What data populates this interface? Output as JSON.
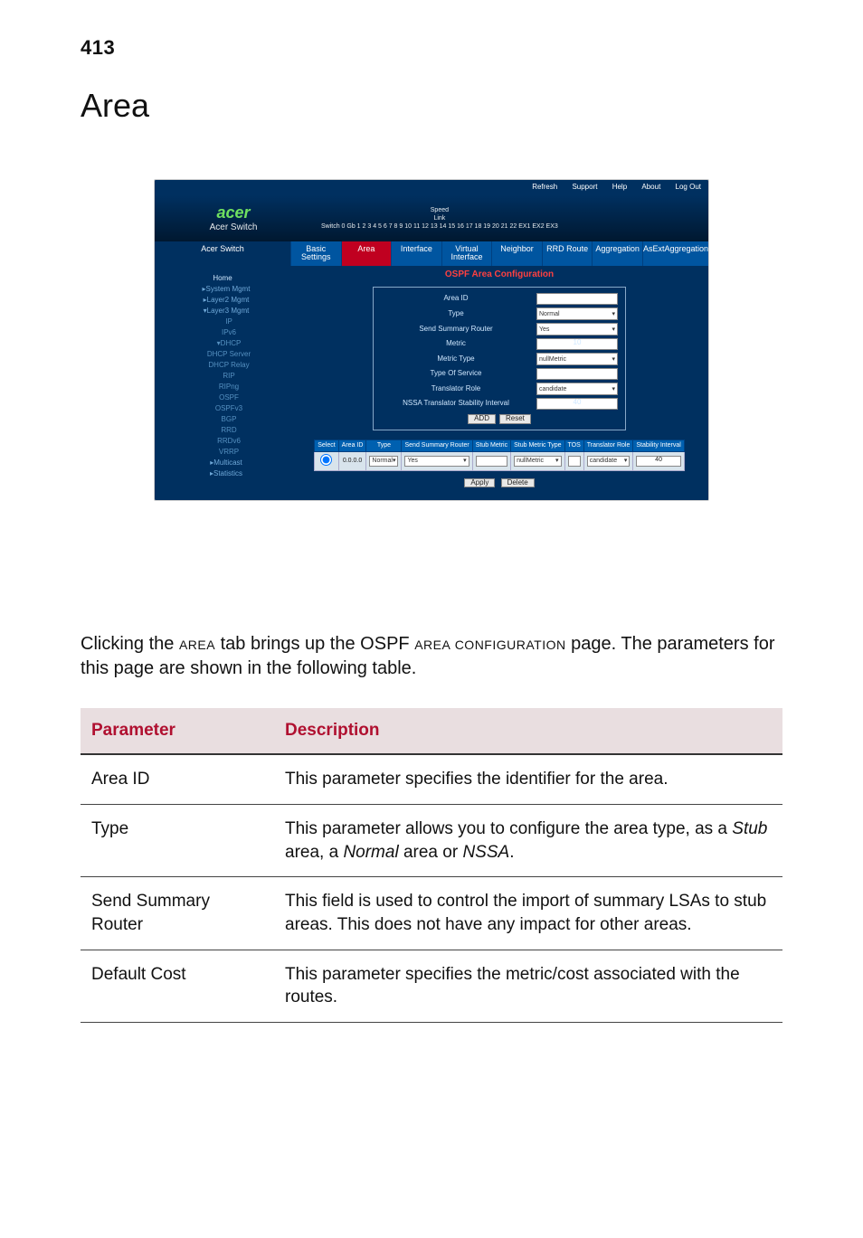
{
  "page_number": "413",
  "title": "Area",
  "figure": {
    "topbar": [
      "Refresh",
      "Support",
      "Help",
      "About",
      "Log Out"
    ],
    "brand": {
      "logo": "acer",
      "sub": "Acer Switch"
    },
    "portlabels": {
      "l1": "Speed",
      "l2": "Link",
      "l3": "Switch 0 Gb 1  2  3  4  5  6  7  8  9 10 11 12 13 14 15 16 17 18 19 20 21 22 EX1 EX2 EX3"
    },
    "tabs_side": "Acer Switch",
    "tabs": [
      "Basic Settings",
      "Area",
      "Interface",
      "Virtual Interface",
      "Neighbor",
      "RRD Route",
      "Aggregation",
      "AsExtAggregation"
    ],
    "tabs_active_index": 1,
    "side_items": [
      {
        "t": "Home",
        "cls": "hdr"
      },
      {
        "t": "▸System Mgmt",
        "cls": "sub"
      },
      {
        "t": "▸Layer2 Mgmt",
        "cls": "sub"
      },
      {
        "t": "▾Layer3 Mgmt",
        "cls": "sub"
      },
      {
        "t": "IP",
        "cls": "sub2"
      },
      {
        "t": "IPv6",
        "cls": "sub2"
      },
      {
        "t": "▾DHCP",
        "cls": "sub2"
      },
      {
        "t": "DHCP Server",
        "cls": "sub2"
      },
      {
        "t": "DHCP Relay",
        "cls": "sub2"
      },
      {
        "t": "RIP",
        "cls": "sub2"
      },
      {
        "t": "RIPng",
        "cls": "sub2"
      },
      {
        "t": "OSPF",
        "cls": "sub2"
      },
      {
        "t": "OSPFv3",
        "cls": "sub2"
      },
      {
        "t": "BGP",
        "cls": "sub2"
      },
      {
        "t": "RRD",
        "cls": "sub2"
      },
      {
        "t": "RRDv6",
        "cls": "sub2"
      },
      {
        "t": "VRRP",
        "cls": "sub2"
      },
      {
        "t": "▸Multicast",
        "cls": "sub"
      },
      {
        "t": "▸Statistics",
        "cls": "sub"
      }
    ],
    "main_title": "OSPF Area Configuration",
    "form_rows": [
      {
        "label": "Area ID",
        "ctl": "input",
        "val": ""
      },
      {
        "label": "Type",
        "ctl": "select",
        "val": "Normal"
      },
      {
        "label": "Send Summary Router",
        "ctl": "select",
        "val": "Yes"
      },
      {
        "label": "Metric",
        "ctl": "input",
        "val": "10"
      },
      {
        "label": "Metric Type",
        "ctl": "select",
        "val": "nullMetric"
      },
      {
        "label": "Type Of Service",
        "ctl": "input",
        "val": ""
      },
      {
        "label": "Translator Role",
        "ctl": "select",
        "val": "candidate"
      },
      {
        "label": "NSSA Translator Stability Interval",
        "ctl": "input",
        "val": "40"
      }
    ],
    "form_actions": [
      "ADD",
      "Reset"
    ],
    "table_headers": [
      "Select",
      "Area ID",
      "Type",
      "Send Summary Router",
      "Stub Metric",
      "Stub Metric Type",
      "TOS",
      "Translator Role",
      "Stability Interval"
    ],
    "table_row": {
      "areaid": "0.0.0.0",
      "type": "Normal",
      "ssr": "Yes",
      "metric": "",
      "mtype": "nullMetric",
      "tos": "",
      "trole": "candidate",
      "sint": "40"
    },
    "lower_actions": [
      "Apply",
      "Delete"
    ]
  },
  "body_text": {
    "p1a": "Clicking the ",
    "p1b": "Area",
    "p1c": " tab brings up the OSPF ",
    "p1d": "Area Configuration",
    "p1e": " page. The parameters for this page are shown in the following table."
  },
  "table": {
    "head_param": "Parameter",
    "head_desc": "Description",
    "rows": [
      {
        "param": "Area ID",
        "desc": "This parameter specifies the identifier for the area."
      },
      {
        "param": "Type",
        "desc_parts": [
          "This parameter allows you to configure the area type, as a ",
          "Stub",
          " area, a ",
          "Normal",
          " area or ",
          "NSSA",
          "."
        ]
      },
      {
        "param": "Send Summary Router",
        "desc": "This field is used to control the import of summary LSAs to stub areas. This does not have any impact for other areas."
      },
      {
        "param": "Default Cost",
        "desc": "This parameter specifies the metric/cost associated with the routes."
      }
    ]
  }
}
